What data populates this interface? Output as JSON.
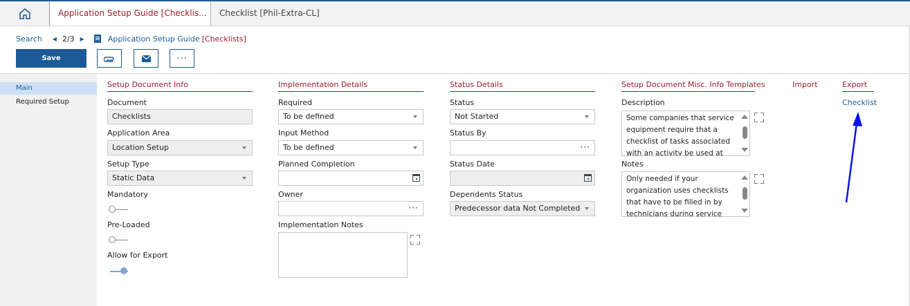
{
  "tabs": [
    {
      "label": "Application Setup Guide [Checklis..."
    },
    {
      "label": "Checklist [Phil-Extra-CL]"
    }
  ],
  "nav": {
    "search": "Search",
    "pager": "2/3",
    "breadcrumb_main": "Application Setup Guide",
    "breadcrumb_sub": "[Checklists]"
  },
  "toolbar": {
    "save": "Save"
  },
  "sidebar": {
    "items": [
      {
        "label": "Main"
      },
      {
        "label": "Required Setup"
      }
    ]
  },
  "sections": {
    "setup_doc": {
      "title": "Setup Document Info",
      "document_label": "Document",
      "document_value": "Checklists",
      "area_label": "Application Area",
      "area_value": "Location Setup",
      "type_label": "Setup Type",
      "type_value": "Static Data",
      "mandatory_label": "Mandatory",
      "mandatory_on": false,
      "preloaded_label": "Pre-Loaded",
      "preloaded_on": false,
      "export_label": "Allow for Export",
      "export_on": true
    },
    "impl": {
      "title": "Implementation Details",
      "required_label": "Required",
      "required_value": "To be defined",
      "input_label": "Input Method",
      "input_value": "To be defined",
      "planned_label": "Planned Completion",
      "planned_value": "",
      "owner_label": "Owner",
      "owner_value": "",
      "notes_label": "Implementation Notes",
      "notes_value": ""
    },
    "status": {
      "title": "Status Details",
      "status_label": "Status",
      "status_value": "Not Started",
      "by_label": "Status By",
      "by_value": "",
      "date_label": "Status Date",
      "date_value": "",
      "dep_label": "Dependents Status",
      "dep_value": "Predecessor data Not Completed"
    },
    "misc": {
      "title": "Setup Document Misc. Info Templates",
      "desc_label": "Description",
      "desc_text": "Some companies that service equipment require that a checklist of tasks associated with an activity be used at the",
      "notes_label": "Notes",
      "notes_text": "Only needed if your organization uses checklists that have to be filled in by technicians during service"
    },
    "import": {
      "title": "Import"
    },
    "export": {
      "title": "Export",
      "link": "Checklist"
    }
  },
  "colors": {
    "accent": "#1b5a96",
    "section": "#9c1d2f",
    "annotation": "#0a14e6"
  }
}
